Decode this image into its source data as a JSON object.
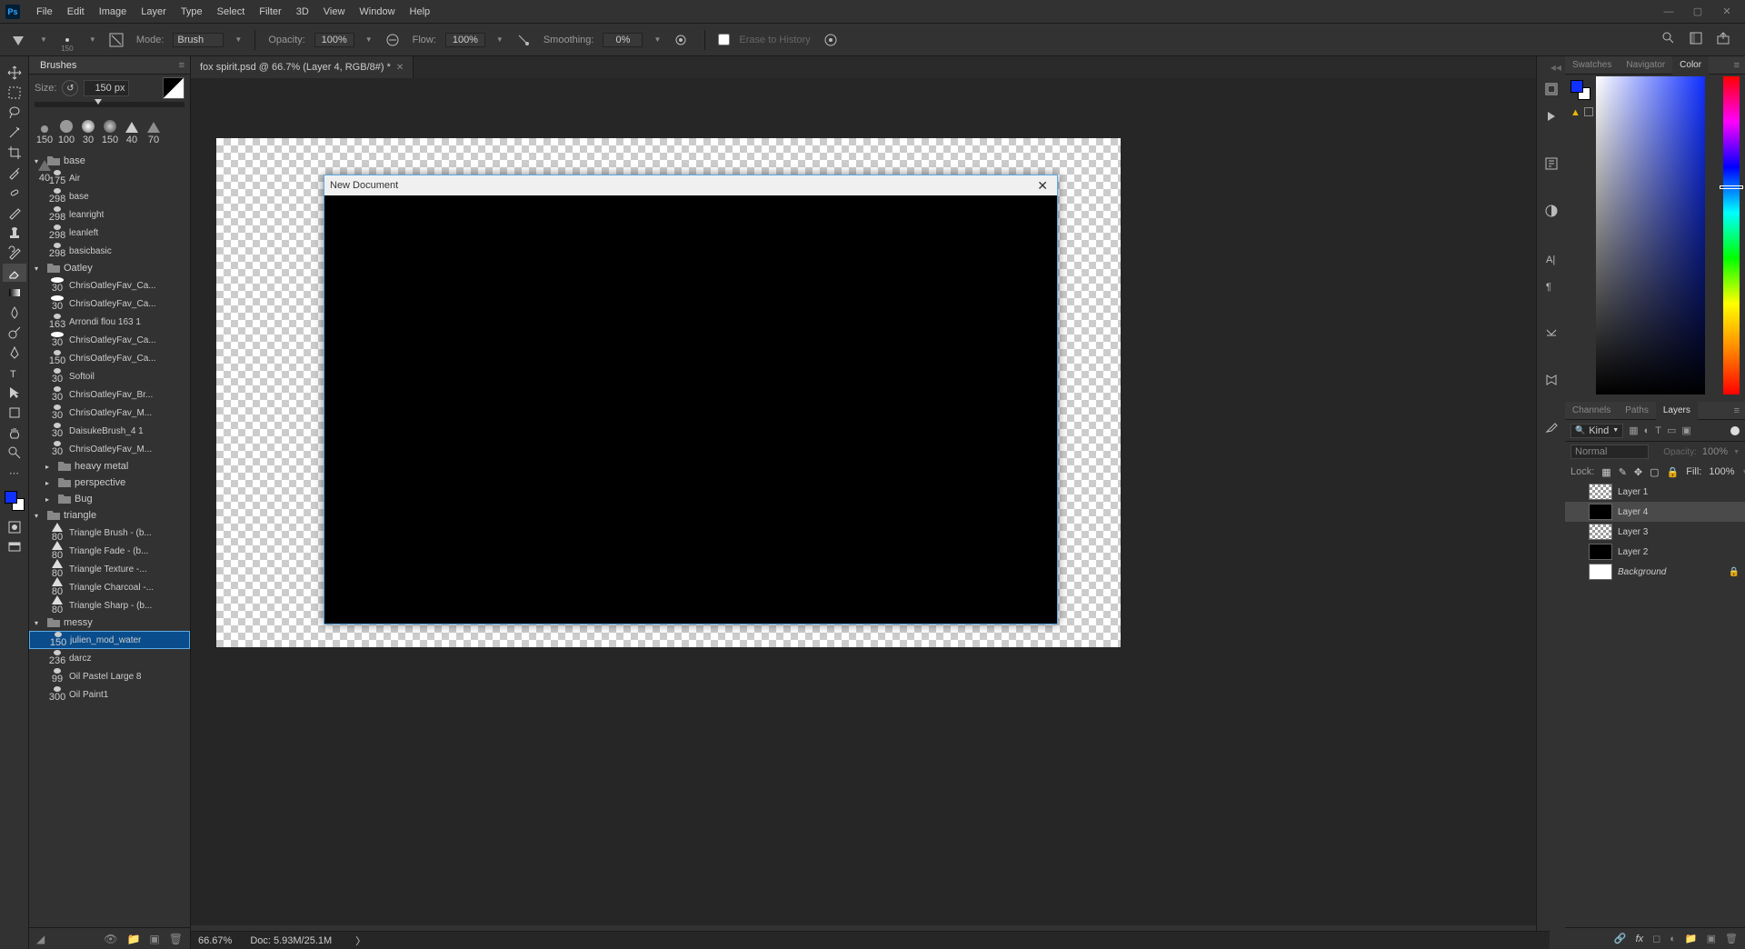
{
  "menubar": {
    "logo": "Ps",
    "items": [
      "File",
      "Edit",
      "Image",
      "Layer",
      "Type",
      "Select",
      "Filter",
      "3D",
      "View",
      "Window",
      "Help"
    ]
  },
  "optbar": {
    "brush_size_label": "150",
    "mode_label": "Mode:",
    "mode_value": "Brush",
    "opacity_label": "Opacity:",
    "opacity_value": "100%",
    "flow_label": "Flow:",
    "flow_value": "100%",
    "smoothing_label": "Smoothing:",
    "smoothing_value": "0%",
    "erase_history": "Erase to History"
  },
  "doc_tab": {
    "title": "fox spirit.psd @ 66.7% (Layer 4, RGB/8#) *"
  },
  "brushes": {
    "panel_title": "Brushes",
    "size_label": "Size:",
    "size_value": "150 px",
    "preset_thumbs": [
      {
        "label": "150"
      },
      {
        "label": "100"
      },
      {
        "label": "30"
      },
      {
        "label": "150"
      },
      {
        "label": "40"
      },
      {
        "label": "70"
      },
      {
        "label": "40"
      }
    ],
    "folders": [
      {
        "name": "base",
        "open": true,
        "items": [
          {
            "name": "Air",
            "size": "175"
          },
          {
            "name": "base",
            "size": "298"
          },
          {
            "name": "leanright",
            "size": "298"
          },
          {
            "name": "leanleft",
            "size": "298"
          },
          {
            "name": "basicbasic",
            "size": "298"
          }
        ]
      },
      {
        "name": "Oatley",
        "open": true,
        "items": [
          {
            "name": "ChrisOatleyFav_Ca...",
            "size": "30",
            "big": true
          },
          {
            "name": "ChrisOatleyFav_Ca...",
            "size": "30",
            "big": true
          },
          {
            "name": "Arrondi flou 163 1",
            "size": "163"
          },
          {
            "name": "ChrisOatleyFav_Ca...",
            "size": "30",
            "big": true
          },
          {
            "name": "ChrisOatleyFav_Ca...",
            "size": "150"
          },
          {
            "name": "Softoil",
            "size": "30"
          },
          {
            "name": "ChrisOatleyFav_Br...",
            "size": "30"
          },
          {
            "name": "ChrisOatleyFav_M...",
            "size": "30"
          },
          {
            "name": "DaisukeBrush_4 1",
            "size": "30"
          },
          {
            "name": "ChrisOatleyFav_M...",
            "size": "30"
          }
        ],
        "subfolders": [
          {
            "name": "heavy metal"
          },
          {
            "name": "perspective"
          },
          {
            "name": "Bug"
          }
        ]
      },
      {
        "name": "triangle",
        "open": true,
        "items": [
          {
            "name": "Triangle Brush - (b...",
            "size": "80",
            "tri": true
          },
          {
            "name": "Triangle Fade - (b...",
            "size": "80",
            "tri": true
          },
          {
            "name": "Triangle Texture -...",
            "size": "80",
            "tri": true
          },
          {
            "name": "Triangle Charcoal -...",
            "size": "80",
            "tri": true
          },
          {
            "name": "Triangle Sharp - (b...",
            "size": "80",
            "tri": true
          }
        ]
      },
      {
        "name": "messy",
        "open": true,
        "items": [
          {
            "name": "julien_mod_water",
            "size": "150",
            "selected": true
          },
          {
            "name": "darcz",
            "size": "236"
          },
          {
            "name": "Oil Pastel Large 8",
            "size": "99"
          },
          {
            "name": "Oil Paint1",
            "size": "300"
          }
        ]
      }
    ]
  },
  "modal": {
    "title": "New Document"
  },
  "right_tabs_top": [
    "Swatches",
    "Navigator",
    "Color"
  ],
  "right_tabs_bottom": [
    "Channels",
    "Paths",
    "Layers"
  ],
  "layers": {
    "kind_label": "Kind",
    "blend_mode": "Normal",
    "opacity_label": "Opacity:",
    "opacity_value": "100%",
    "lock_label": "Lock:",
    "fill_label": "Fill:",
    "fill_value": "100%",
    "items": [
      {
        "name": "Layer 1",
        "thumb": "checker"
      },
      {
        "name": "Layer 4",
        "thumb": "black",
        "selected": true
      },
      {
        "name": "Layer 3",
        "thumb": "checker"
      },
      {
        "name": "Layer 2",
        "thumb": "black"
      },
      {
        "name": "Background",
        "thumb": "white",
        "locked": true,
        "italic": true
      }
    ]
  },
  "statusbar": {
    "zoom": "66.67%",
    "doc_info": "Doc: 5.93M/25.1M"
  }
}
